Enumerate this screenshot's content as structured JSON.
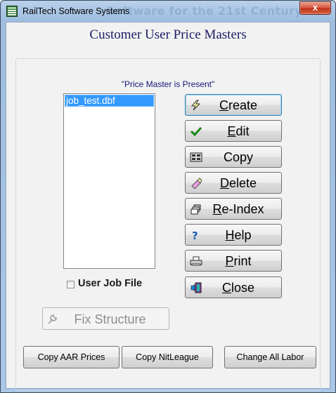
{
  "window": {
    "title": "RailTech Software Systems",
    "title_watermark": "Software for the 21st Century",
    "close_glyph": "x"
  },
  "heading": "Customer User Price Masters",
  "status_text": "\"Price Master is Present\"",
  "file_list": {
    "items": [
      "job_test.dbf"
    ],
    "selected": "job_test.dbf"
  },
  "buttons": {
    "create": {
      "label": "Create",
      "underline": "C",
      "rest": "reate",
      "icon": "lightning-icon"
    },
    "edit": {
      "label": "Edit",
      "underline": "E",
      "rest": "dit",
      "icon": "checkmark-icon"
    },
    "copy": {
      "label": "Copy",
      "underline": "",
      "rest": "Copy",
      "icon": "copy-records-icon"
    },
    "delete": {
      "label": "Delete",
      "underline": "D",
      "rest": "elete",
      "icon": "eraser-icon"
    },
    "reindex": {
      "label": "Re-Index",
      "underline": "R",
      "rest": "e-Index",
      "icon": "stack-icon"
    },
    "help": {
      "label": "Help",
      "underline": "H",
      "rest": "elp",
      "icon": "question-icon"
    },
    "print": {
      "label": "Print",
      "underline": "P",
      "rest": "rint",
      "icon": "printer-icon"
    },
    "close": {
      "label": "Close",
      "underline": "C",
      "rest": "lose",
      "icon": "exit-door-icon"
    }
  },
  "user_job_file": {
    "label": "User Job File",
    "checked": false
  },
  "fix_structure": {
    "label": "Fix Structure",
    "enabled": false,
    "icon": "wrench-icon"
  },
  "bottom_buttons": {
    "copy_aar": "Copy AAR Prices",
    "copy_nitleague": "Copy NitLeague",
    "change_all_labor": "Change All Labor"
  },
  "colors": {
    "heading": "#1d1d66",
    "selection": "#3399ff",
    "window_frame": "#a9c6e6",
    "close_button": "#c0301a"
  }
}
